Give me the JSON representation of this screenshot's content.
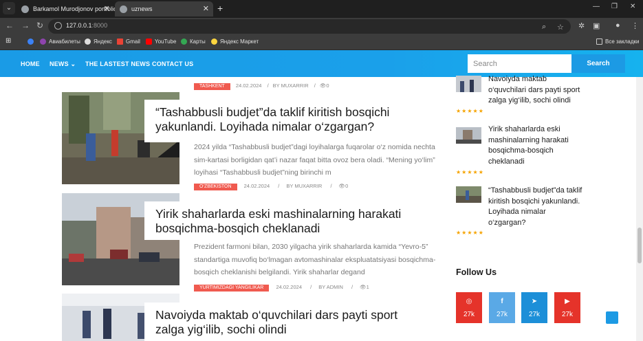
{
  "browser": {
    "tabs": [
      {
        "label": "Barkamol Murodjonov portfolio"
      },
      {
        "label": "uznews"
      }
    ],
    "url": {
      "host": "127.0.0.1",
      "port": ":8000"
    },
    "bookmarks": [
      {
        "label": "Авиабилеты"
      },
      {
        "label": "Яндекс"
      },
      {
        "label": "Gmail"
      },
      {
        "label": "YouTube"
      },
      {
        "label": "Карты"
      },
      {
        "label": "Яндекс Маркет"
      }
    ],
    "all_bookmarks": "Все закладки"
  },
  "nav": {
    "home": "HOME",
    "news": "NEWS",
    "latest": "THE LASTEST NEWS",
    "contact": "CONTACT US",
    "search_placeholder": "Search",
    "search_button": "Search"
  },
  "top_meta": {
    "category": "TASHKENT",
    "date": "24.02.2024",
    "author": "BY MUXARRIR",
    "views": "0"
  },
  "articles": [
    {
      "title": "“Tashabbusli budjet”da taklif kiritish bosqichi yakunlandi. Loyihada nimalar o‘zgargan?",
      "excerpt": "2024 yilda “Tashabbusli budjet”dagi loyihalarga fuqarolar o‘z nomida nechta sim-kartasi borligidan qat’i nazar faqat bitta ovoz bera oladi. “Mening yo‘lim” loyihasi “Tashabbusli budjet”ning birinchi m",
      "category": "O‘ZBEKISTON",
      "date": "24.02.2024",
      "author": "BY MUXARRIR",
      "views": "0"
    },
    {
      "title": "Yirik shaharlarda eski mashinalarning harakati bosqichma-bosqich cheklanadi",
      "excerpt": "Prezident farmoni bilan, 2030 yilgacha yirik shaharlarda kamida “Yevro-5” standartiga muvofiq bo‘lmagan avtomashinalar ekspluatatsiyasi bosqichma-bosqich cheklanishi belgilandi. Yirik shaharlar degand",
      "category": "YURTIMIZDAGI YANGILIKAR",
      "date": "24.02.2024",
      "author": "BY ADMIN",
      "views": "1"
    },
    {
      "title": "Navoiyda maktab o‘quvchilari dars payti sport zalga yig‘ilib, sochi olindi"
    }
  ],
  "sidebar": {
    "posts": [
      {
        "title": "Navoiyda maktab o‘quvchilari dars payti sport zalga yig‘ilib, sochi olindi",
        "rating": 5
      },
      {
        "title": "Yirik shaharlarda eski mashinalarning harakati bosqichma-bosqich cheklanadi",
        "rating": 5
      },
      {
        "title": "“Tashabbusli budjet”da taklif kiritish bosqichi yakunlandi. Loyihada nimalar o‘zgargan?",
        "rating": 5
      }
    ],
    "follow_title": "Follow Us",
    "social": [
      {
        "icon": "instagram-icon",
        "count": "27k",
        "color": "#e5332a"
      },
      {
        "icon": "facebook-icon",
        "count": "27k",
        "color": "#5aa9e6"
      },
      {
        "icon": "telegram-icon",
        "count": "27k",
        "color": "#1c8fd8"
      },
      {
        "icon": "youtube-icon",
        "count": "27k",
        "color": "#e5332a"
      }
    ]
  }
}
